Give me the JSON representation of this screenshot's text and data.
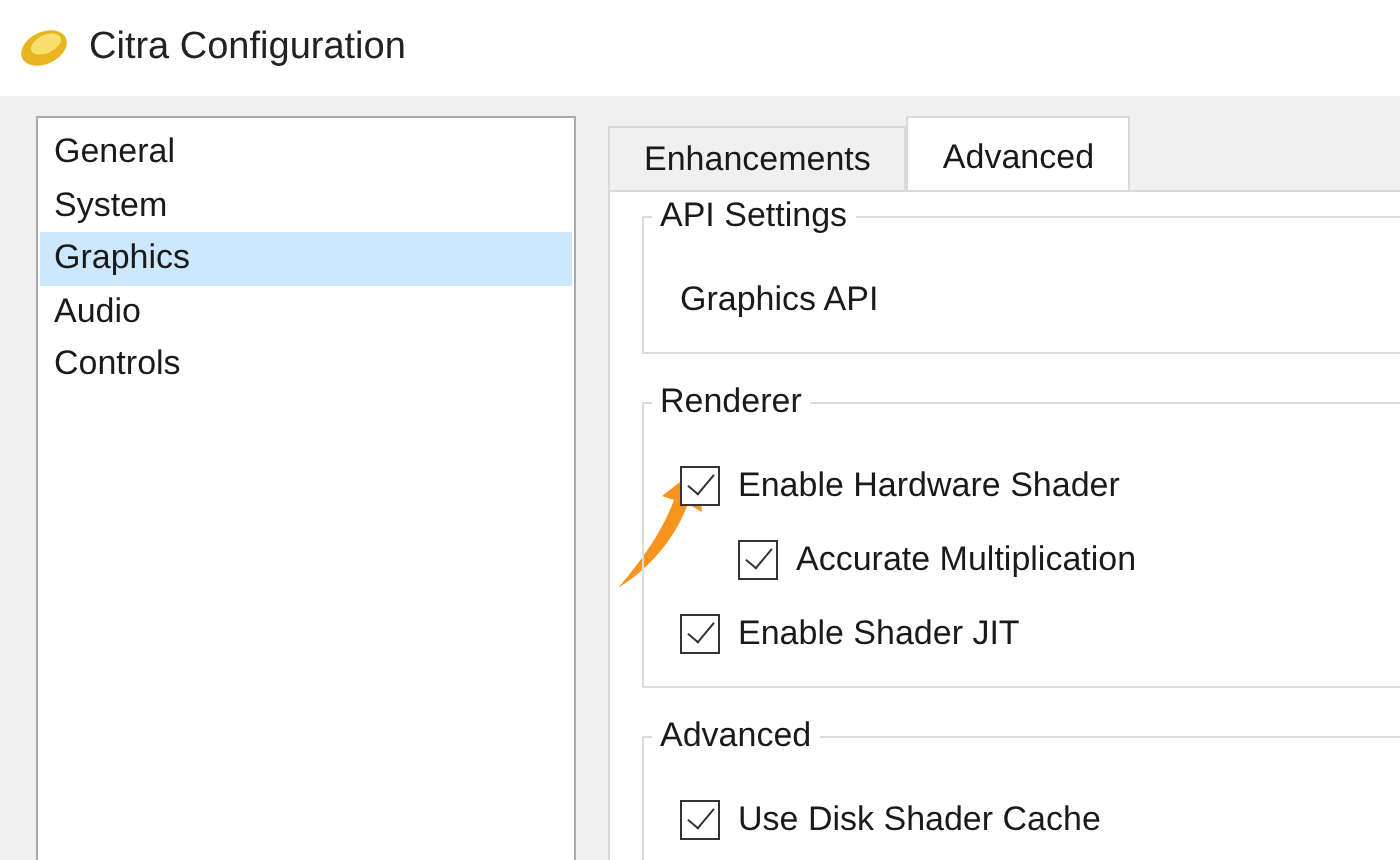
{
  "window": {
    "title": "Citra Configuration"
  },
  "sidebar": {
    "items": [
      {
        "label": "General",
        "selected": false
      },
      {
        "label": "System",
        "selected": false
      },
      {
        "label": "Graphics",
        "selected": true
      },
      {
        "label": "Audio",
        "selected": false
      },
      {
        "label": "Controls",
        "selected": false
      }
    ]
  },
  "tabs": [
    {
      "label": "Enhancements",
      "selected": false
    },
    {
      "label": "Advanced",
      "selected": true
    }
  ],
  "groups": [
    {
      "title": "API Settings",
      "items": [
        {
          "kind": "label",
          "label": "Graphics API"
        }
      ]
    },
    {
      "title": "Renderer",
      "items": [
        {
          "kind": "checkbox",
          "label": "Enable Hardware Shader",
          "checked": true,
          "children": [
            {
              "kind": "checkbox",
              "label": "Accurate Multiplication",
              "checked": true
            }
          ]
        },
        {
          "kind": "checkbox",
          "label": "Enable Shader JIT",
          "checked": true
        }
      ]
    },
    {
      "title": "Advanced",
      "items": [
        {
          "kind": "checkbox",
          "label": "Use Disk Shader Cache",
          "checked": true
        }
      ]
    }
  ]
}
